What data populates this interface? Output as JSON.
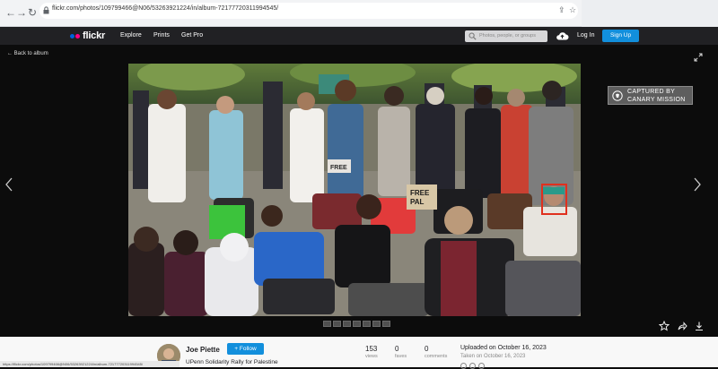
{
  "browser": {
    "url": "flickr.com/photos/109799466@N06/53263921224/in/album-72177720311994545/"
  },
  "header": {
    "nav": [
      "Explore",
      "Prints",
      "Get Pro"
    ],
    "search_placeholder": "Photos, people, or groups",
    "login_label": "Log In",
    "signup_label": "Sign Up",
    "logo_text": "flickr",
    "colors": {
      "brand_blue": "#0063dc",
      "brand_pink": "#ff0084",
      "button_blue": "#128fdc"
    }
  },
  "lightbox": {
    "back_label": "Back to album",
    "watermark": {
      "line1": "CAPTURED BY",
      "line2": "CANARY MISSION"
    },
    "signs": {
      "free": "FREE",
      "palestine": "FREE\nPAL"
    },
    "highlight_color": "#e0301e"
  },
  "footer": {
    "author": "Joe Piette",
    "follow_label": "+ Follow",
    "title": "UPenn Solidarity Rally for Palestine",
    "stats": [
      {
        "value": "153",
        "label": "views"
      },
      {
        "value": "0",
        "label": "faves"
      },
      {
        "value": "0",
        "label": "comments"
      }
    ],
    "uploaded": "Uploaded on October 16, 2023",
    "taken": "Taken on October 16, 2023",
    "status_url": "https://flickr.com/photos/109799466@N06/53263921224/in/album-72177720311994545/"
  }
}
